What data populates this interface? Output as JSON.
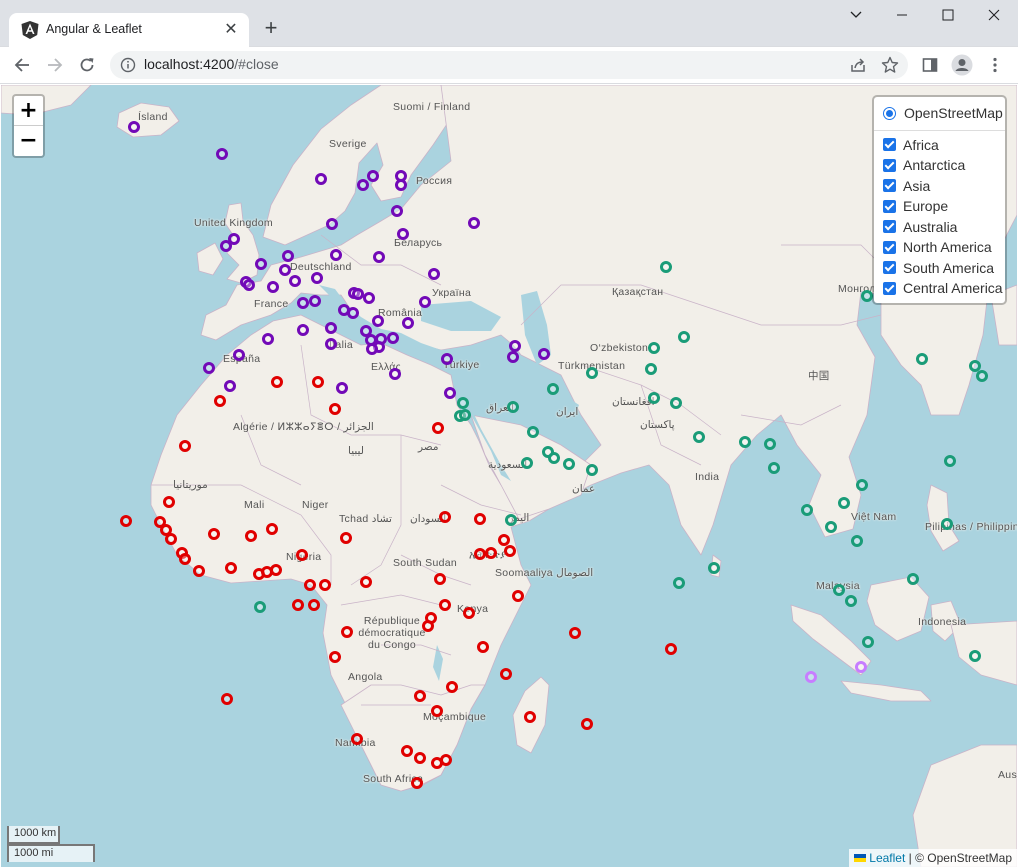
{
  "tab": {
    "title": "Angular & Leaflet",
    "close_glyph": "✕",
    "new_tab_glyph": "+"
  },
  "address": {
    "host": "localhost:4200",
    "path": "/#close"
  },
  "icons": {
    "favicon": "angular-icon",
    "back": "arrow-left-icon",
    "forward": "arrow-right-icon",
    "reload": "reload-icon",
    "info": "info-icon",
    "share": "share-icon",
    "bookmark": "star-icon",
    "side_panel": "side-panel-icon",
    "profile": "profile-icon",
    "menu": "kebab-menu-icon"
  },
  "map": {
    "zoom_in": "+",
    "zoom_out": "−",
    "base_layer": "OpenStreetMap",
    "overlays": [
      "Africa",
      "Antarctica",
      "Asia",
      "Europe",
      "Australia",
      "North America",
      "South America",
      "Central America"
    ],
    "scale_km": "1000 km",
    "scale_mi": "1000 mi",
    "attribution_link": "Leaflet",
    "attribution_text": "| © OpenStreetMap",
    "colors": {
      "Europe": "#7209b7",
      "Africa": "#e00000",
      "Asia": "#1a9c78",
      "Australia": "#c77dff",
      "water": "#aad3df",
      "land": "#f2efe9"
    },
    "place_labels": [
      "Ísland",
      "Suomi / Finland",
      "Sverige",
      "Россия",
      "United Kingdom",
      "Беларусь",
      "Deutschland",
      "Україна",
      "France",
      "România",
      "España",
      "Italia",
      "Ελλάς",
      "Türkiye",
      "Қазақстан",
      "Монгол улс ᠮᠣᠩᠭᠣᠯ",
      "O‘zbekiston",
      "Türkmenistan",
      "中国",
      "Algérie / ⵍⵣⵣⴰⵢⴻⵔ / الجزائر",
      "ليبيا",
      "مصر",
      "العراق",
      "ایران",
      "افغانستان",
      "پاکستان",
      "India",
      "السعودية",
      "عمان",
      "موريتانيا",
      "Mali",
      "Niger",
      "Tchad تشاد",
      "السودان",
      "اليمن",
      "Việt Nam",
      "Pilipinas / Philippines",
      "Nigeria",
      "South Sudan",
      "ኢትዮጵያ",
      "Soomaaliya الصومال",
      "Kenya",
      "Malaysia",
      "Indonesia",
      "République démocratique du Congo",
      "Angola",
      "Moçambique",
      "Namibia",
      "South Africa",
      "Aus"
    ],
    "markers": {
      "Europe": 63,
      "Africa": 75,
      "Asia": 50,
      "Australia": 2
    }
  }
}
